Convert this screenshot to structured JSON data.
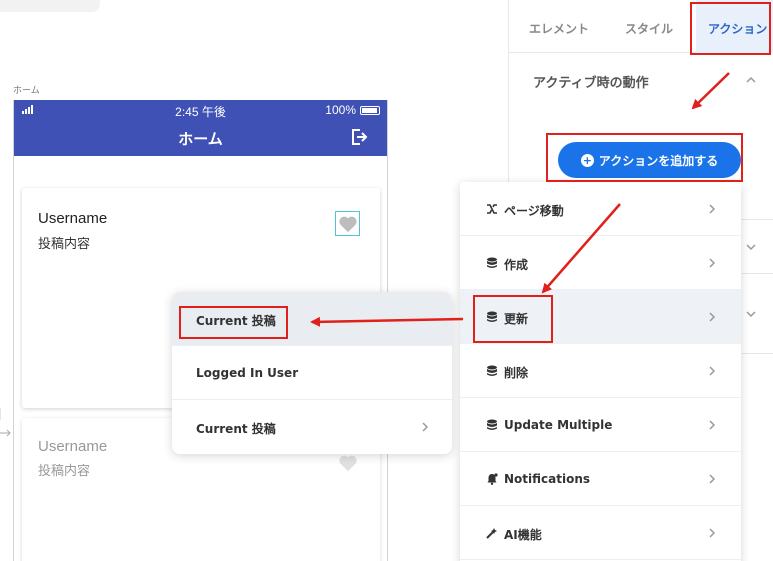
{
  "canvas": {
    "screen_label": "ホーム"
  },
  "phone": {
    "status": {
      "time": "2:45 午後",
      "battery": "100%"
    },
    "header": {
      "title": "ホーム"
    },
    "posts": [
      {
        "username": "Username",
        "content": "投稿内容"
      },
      {
        "username": "Username",
        "content": "投稿内容"
      }
    ]
  },
  "panel": {
    "tabs": [
      "エレメント",
      "スタイル",
      "アクション"
    ],
    "section_title": "アクティブ時の動作",
    "add_action_label": "アクションを追加する"
  },
  "action_menu": {
    "items": [
      {
        "label": "ページ移動",
        "icon": "navigate-icon"
      },
      {
        "label": "作成",
        "icon": "database-icon"
      },
      {
        "label": "更新",
        "icon": "database-icon"
      },
      {
        "label": "削除",
        "icon": "database-icon"
      },
      {
        "label": "Update Multiple",
        "icon": "database-icon"
      },
      {
        "label": "Notifications",
        "icon": "bell-icon"
      },
      {
        "label": "AI機能",
        "icon": "magic-wand-icon"
      }
    ]
  },
  "submenu": {
    "items": [
      {
        "label": "Current 投稿"
      },
      {
        "label": "Logged In User"
      },
      {
        "label": "Current 投稿"
      }
    ]
  },
  "colors": {
    "app_bar": "#3f51b5",
    "accent_blue": "#1a73e8",
    "active_tab_bg": "#e8f0fb",
    "annotation_red": "#e0201a"
  }
}
